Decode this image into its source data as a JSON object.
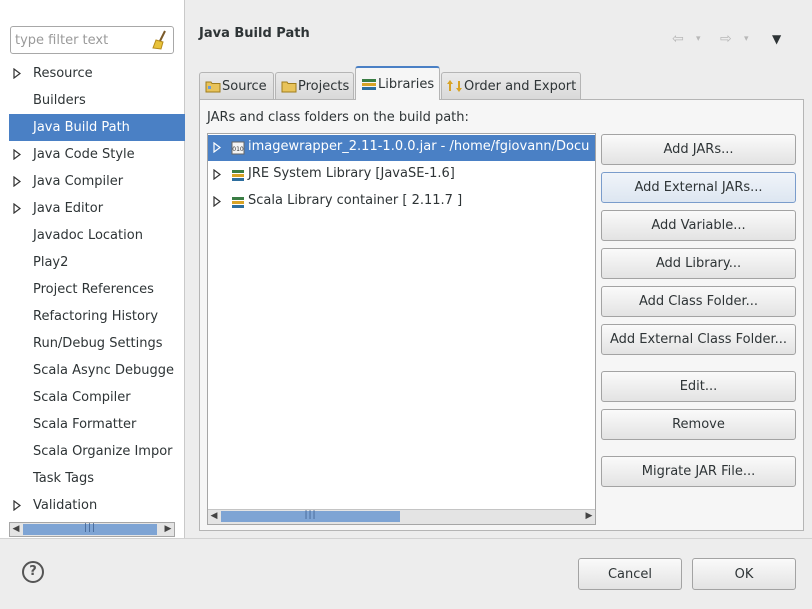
{
  "filter": {
    "placeholder": "type filter text",
    "icon": "broom-icon"
  },
  "sidebar": {
    "items": [
      {
        "label": "Resource",
        "expandable": true
      },
      {
        "label": "Builders",
        "expandable": false
      },
      {
        "label": "Java Build Path",
        "expandable": false,
        "selected": true
      },
      {
        "label": "Java Code Style",
        "expandable": true
      },
      {
        "label": "Java Compiler",
        "expandable": true
      },
      {
        "label": "Java Editor",
        "expandable": true
      },
      {
        "label": "Javadoc Location",
        "expandable": false
      },
      {
        "label": "Play2",
        "expandable": false
      },
      {
        "label": "Project References",
        "expandable": false
      },
      {
        "label": "Refactoring History",
        "expandable": false
      },
      {
        "label": "Run/Debug Settings",
        "expandable": false
      },
      {
        "label": "Scala Async Debugge",
        "expandable": false
      },
      {
        "label": "Scala Compiler",
        "expandable": false
      },
      {
        "label": "Scala Formatter",
        "expandable": false
      },
      {
        "label": "Scala Organize Impor",
        "expandable": false
      },
      {
        "label": "Task Tags",
        "expandable": false
      },
      {
        "label": "Validation",
        "expandable": true
      }
    ]
  },
  "page": {
    "title": "Java Build Path"
  },
  "tabs": [
    {
      "label": "Source",
      "icon": "source-folder-icon"
    },
    {
      "label": "Projects",
      "icon": "projects-folder-icon"
    },
    {
      "label": "Libraries",
      "icon": "libraries-icon",
      "active": true
    },
    {
      "label": "Order and Export",
      "icon": "order-export-icon"
    }
  ],
  "libraries": {
    "section_label": "JARs and class folders on the build path:",
    "entries": [
      {
        "label": "imagewrapper_2.11-1.0.0.jar - /home/fgiovann/Docu",
        "icon": "jar-icon",
        "selected": true
      },
      {
        "label": "JRE System Library [JavaSE-1.6]",
        "icon": "library-icon",
        "selected": false
      },
      {
        "label": "Scala Library container [ 2.11.7 ]",
        "icon": "library-icon",
        "selected": false
      }
    ]
  },
  "buttons": {
    "add_jars": "Add JARs...",
    "add_external_jars": "Add External JARs...",
    "add_variable": "Add Variable...",
    "add_library": "Add Library...",
    "add_class_folder": "Add Class Folder...",
    "add_external_class_folder": "Add External Class Folder...",
    "edit": "Edit...",
    "remove": "Remove",
    "migrate_jar": "Migrate JAR File..."
  },
  "dialog": {
    "cancel": "Cancel",
    "ok": "OK",
    "help": "?"
  },
  "colors": {
    "selection": "#4a80c5",
    "background": "#ededed"
  }
}
